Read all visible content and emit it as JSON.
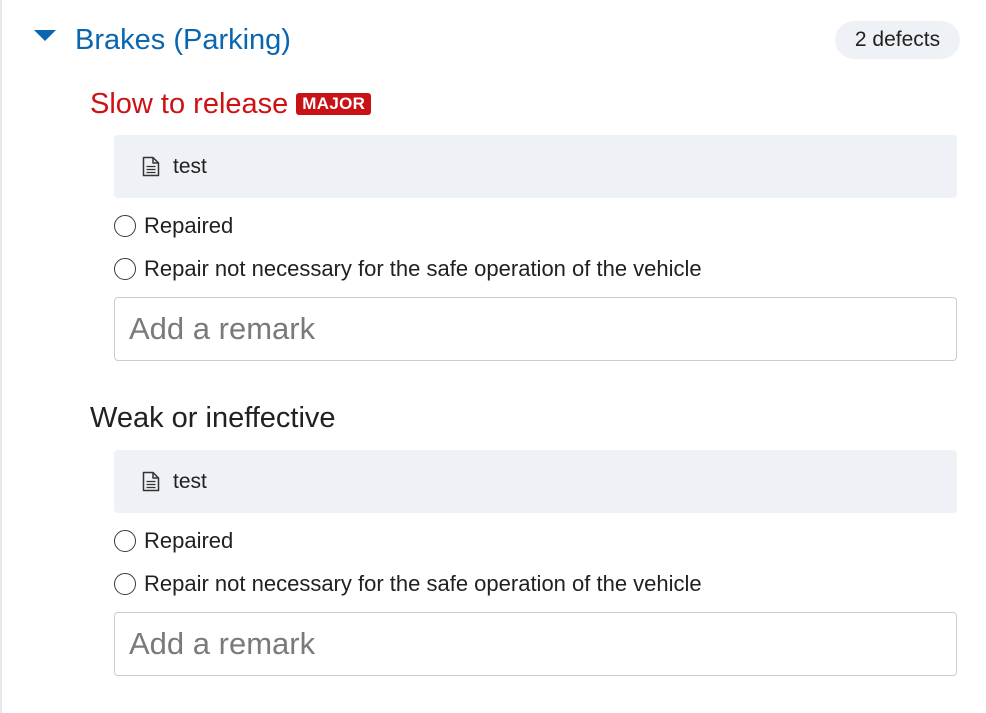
{
  "section": {
    "title": "Brakes (Parking)",
    "defect_count": "2 defects"
  },
  "defects": [
    {
      "title": "Slow to release",
      "severity": "MAJOR",
      "note": "test",
      "options": [
        "Repaired",
        "Repair not necessary for the safe operation of the vehicle"
      ],
      "remark_placeholder": "Add a remark"
    },
    {
      "title": "Weak or ineffective",
      "note": "test",
      "options": [
        "Repaired",
        "Repair not necessary for the safe operation of the vehicle"
      ],
      "remark_placeholder": "Add a remark"
    }
  ],
  "colors": {
    "section_title": "#0a66b0",
    "major_title": "#cc1212",
    "major_badge": "#c81216",
    "note_background": "#eef1f5"
  }
}
